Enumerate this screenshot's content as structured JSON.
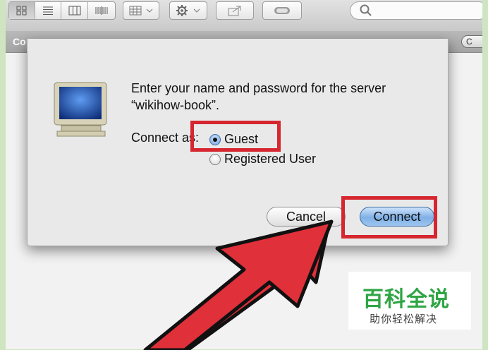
{
  "toolbar": {
    "icons": [
      "icon-view-icon",
      "list-view-icon",
      "column-view-icon",
      "coverflow-view-icon",
      "arrange-icon",
      "action-gear-icon",
      "share-icon",
      "tag-icon",
      "search-icon"
    ]
  },
  "pathbar": {
    "label": "Co",
    "button_label": "C"
  },
  "dialog": {
    "message_line1": "Enter your name and password for the server",
    "message_line2": "“wikihow-book”.",
    "connect_as_label": "Connect as:",
    "options": [
      {
        "label": "Guest",
        "selected": true
      },
      {
        "label": "Registered User",
        "selected": false
      }
    ],
    "cancel_label": "Cancel",
    "connect_label": "Connect"
  },
  "watermark": {
    "title": "百科全说",
    "subtitle": "助你轻松解决"
  },
  "colors": {
    "highlight": "#d6262f",
    "arrow": "#e0303a",
    "accent_button": "#7fb0e6",
    "frame": "#cfe5c2"
  }
}
